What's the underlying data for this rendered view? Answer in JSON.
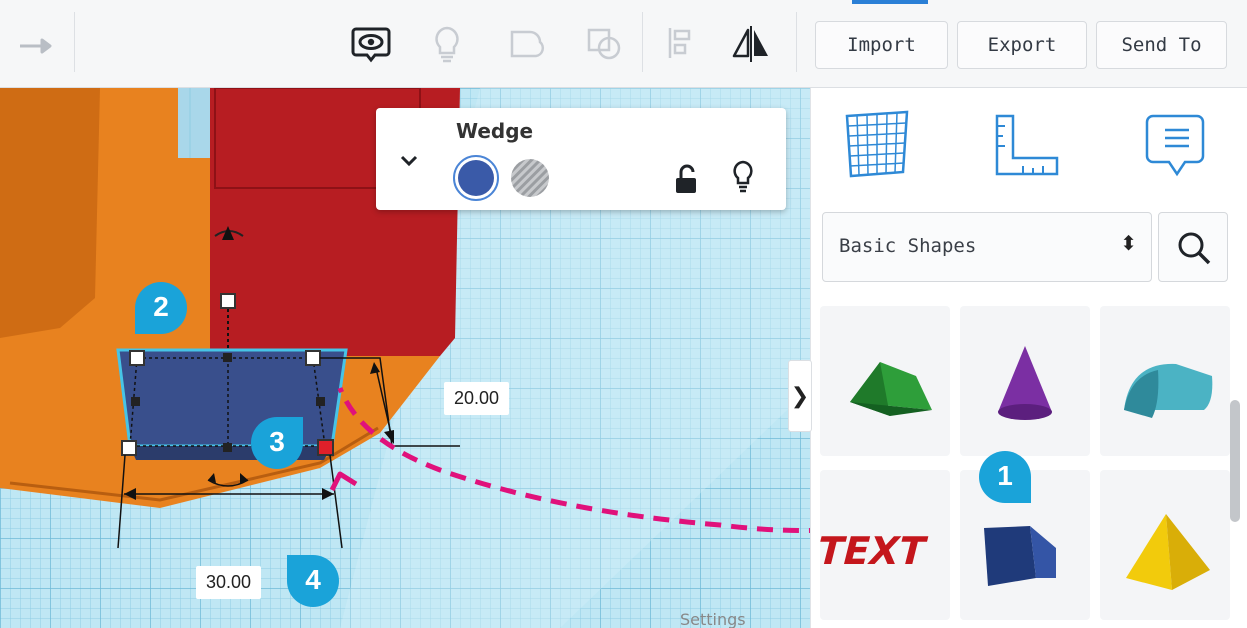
{
  "toolbar": {
    "redo_icon": "redo-arrow-icon",
    "icons": [
      "show-all-icon",
      "lightbulb-icon",
      "group-icon",
      "ungroup-icon",
      "align-icon",
      "mirror-icon"
    ],
    "import_label": "Import",
    "export_label": "Export",
    "send_to_label": "Send To"
  },
  "inspector": {
    "title": "Wedge",
    "solid_color": "#3a5aa8",
    "icons": [
      "chevron-down-icon",
      "solid-color-icon",
      "hole-icon",
      "lock-open-icon",
      "lightbulb-icon"
    ]
  },
  "dimensions": {
    "height": "20.00",
    "width": "30.00"
  },
  "sidebar": {
    "view_icons": [
      "workplane-grid-icon",
      "ruler-icon",
      "notes-icon"
    ],
    "category_select": "Basic Shapes",
    "search_icon": "search-icon",
    "collapse_icon": "chevron-right-icon",
    "shapes": [
      {
        "name": "roof",
        "color": "#2e9e3a"
      },
      {
        "name": "cone",
        "color": "#7b2fa3"
      },
      {
        "name": "half-cylinder",
        "color": "#4bb3c4"
      },
      {
        "name": "text",
        "color": "#c4161c"
      },
      {
        "name": "wedge",
        "color": "#1f3a7a"
      },
      {
        "name": "pyramid",
        "color": "#f2cb0c"
      }
    ],
    "footer": "Settings"
  },
  "callouts": [
    "1",
    "2",
    "3",
    "4"
  ],
  "colors": {
    "callout": "#1aa3d9",
    "arrow": "#e0117b",
    "workplane_grid": "#b8e4f2",
    "orange_shape": "#e8821f",
    "red_shape": "#b81e24",
    "wedge_blue": "#394f8c"
  }
}
